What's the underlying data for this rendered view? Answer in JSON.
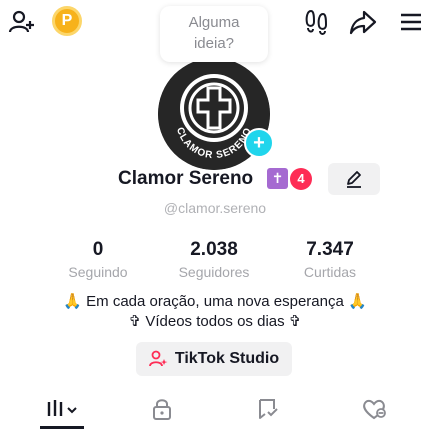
{
  "top_bar": {
    "add_user_icon": "add-user-icon",
    "coin_icon": "coin-icon",
    "coin_letter": "P",
    "idea_bubble_line1": "Alguma",
    "idea_bubble_line2": "ideia?",
    "footprints_icon": "footprints-icon",
    "share_icon": "share-icon",
    "menu_icon": "hamburger-menu-icon"
  },
  "profile": {
    "display_name": "Clamor Sereno",
    "badge_glyph": "✝",
    "notification_count": "4",
    "username": "@clamor.sereno",
    "avatar_text": "CLAMOR SERENO"
  },
  "stats": [
    {
      "value": "0",
      "label": "Seguindo"
    },
    {
      "value": "2.038",
      "label": "Seguidores"
    },
    {
      "value": "7.347",
      "label": "Curtidas"
    }
  ],
  "bio": {
    "line1": "🙏 Em cada oração, uma nova esperança 🙏",
    "line2": "✞ Vídeos todos os dias ✞"
  },
  "studio_button": {
    "label": "TikTok Studio"
  },
  "tabs": [
    {
      "icon": "videos-grid-icon",
      "active": true
    },
    {
      "icon": "lock-icon",
      "active": false
    },
    {
      "icon": "repost-icon",
      "active": false
    },
    {
      "icon": "liked-icon",
      "active": false
    }
  ],
  "colors": {
    "accent_red": "#fe2c55",
    "coin": "#F7B21B",
    "plus": "#20d5ec",
    "cross_badge": "#a56ad1"
  }
}
